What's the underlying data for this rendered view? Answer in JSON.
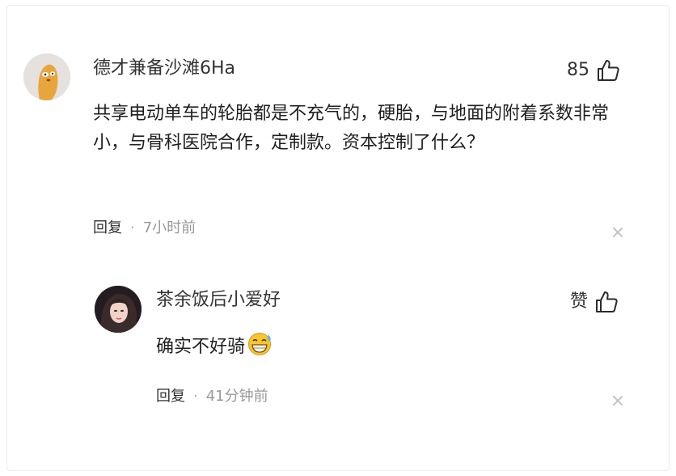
{
  "comment": {
    "username": "德才兼备沙滩6Ha",
    "like_count": "85",
    "body": "共享电动单车的轮胎都是不充气的，硬胎，与地面的附着系数非常小，与骨科医院合作，定制款。资本控制了什么？",
    "reply_label": "回复",
    "separator": "·",
    "time": "7小时前",
    "icons": {
      "like": "thumbs-up-icon",
      "close": "close-icon"
    }
  },
  "reply": {
    "username": "茶余饭后小爱好",
    "like_label": "赞",
    "body": "确实不好骑",
    "emoji": "grinning-sweat-emoji",
    "reply_label": "回复",
    "separator": "·",
    "time": "41分钟前",
    "icons": {
      "like": "thumbs-up-icon",
      "close": "close-icon"
    }
  },
  "colors": {
    "text": "#222222",
    "muted": "#999999",
    "emoji": "#f7c52f"
  }
}
